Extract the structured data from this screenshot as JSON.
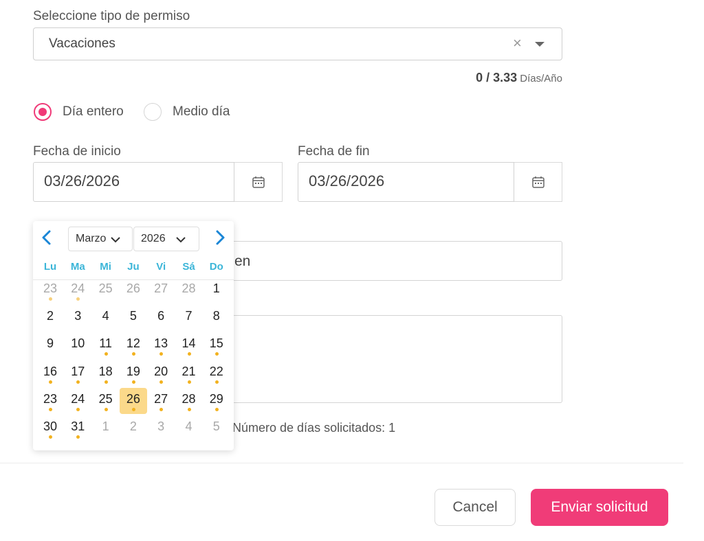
{
  "leave_type": {
    "label": "Seleccione tipo de permiso",
    "value": "Vacaciones",
    "clear_glyph": "×"
  },
  "balance": {
    "used": "0 / 3.33",
    "unit": "Días/Año"
  },
  "duration": {
    "options": [
      {
        "label": "Día entero",
        "checked": true
      },
      {
        "label": "Medio día",
        "checked": false
      }
    ]
  },
  "start_date": {
    "label": "Fecha de inicio",
    "value": "03/26/2026"
  },
  "end_date": {
    "label": "Fecha de fin",
    "value": "03/26/2026"
  },
  "partial_field_text": "en",
  "days_requested": "Número de días solicitados: 1",
  "calendar": {
    "month": "Marzo",
    "year": "2026",
    "weekdays": [
      "Lu",
      "Ma",
      "Mi",
      "Ju",
      "Vi",
      "Sá",
      "Do"
    ],
    "weeks": [
      [
        {
          "d": "23",
          "m": true,
          "dot": "light"
        },
        {
          "d": "24",
          "m": true,
          "dot": "light"
        },
        {
          "d": "25",
          "m": true
        },
        {
          "d": "26",
          "m": true
        },
        {
          "d": "27",
          "m": true
        },
        {
          "d": "28",
          "m": true
        },
        {
          "d": "1"
        }
      ],
      [
        {
          "d": "2"
        },
        {
          "d": "3"
        },
        {
          "d": "4"
        },
        {
          "d": "5"
        },
        {
          "d": "6"
        },
        {
          "d": "7"
        },
        {
          "d": "8"
        }
      ],
      [
        {
          "d": "9"
        },
        {
          "d": "10"
        },
        {
          "d": "11",
          "dot": "on"
        },
        {
          "d": "12",
          "dot": "on"
        },
        {
          "d": "13",
          "dot": "on"
        },
        {
          "d": "14",
          "dot": "on"
        },
        {
          "d": "15",
          "dot": "on"
        }
      ],
      [
        {
          "d": "16",
          "dot": "on"
        },
        {
          "d": "17",
          "dot": "on"
        },
        {
          "d": "18",
          "dot": "on"
        },
        {
          "d": "19",
          "dot": "on"
        },
        {
          "d": "20",
          "dot": "on"
        },
        {
          "d": "21",
          "dot": "on"
        },
        {
          "d": "22",
          "dot": "on"
        }
      ],
      [
        {
          "d": "23",
          "dot": "on"
        },
        {
          "d": "24",
          "dot": "on"
        },
        {
          "d": "25",
          "dot": "on"
        },
        {
          "d": "26",
          "dot": "on",
          "sel": true
        },
        {
          "d": "27",
          "dot": "on"
        },
        {
          "d": "28",
          "dot": "on"
        },
        {
          "d": "29",
          "dot": "on"
        }
      ],
      [
        {
          "d": "30",
          "dot": "on"
        },
        {
          "d": "31",
          "dot": "on"
        },
        {
          "d": "1",
          "m": true
        },
        {
          "d": "2",
          "m": true
        },
        {
          "d": "3",
          "m": true
        },
        {
          "d": "4",
          "m": true
        },
        {
          "d": "5",
          "m": true
        }
      ]
    ]
  },
  "buttons": {
    "cancel": "Cancel",
    "submit": "Enviar solicitud"
  },
  "colors": {
    "accent": "#f03c78",
    "weekday": "#3bb5d8",
    "nav_arrow": "#1a86d6",
    "selected_day": "#fbd98a",
    "dot": "#f2b21f"
  },
  "icons": {
    "calendar": "calendar-icon",
    "caret": "caret-down-icon",
    "prev": "chevron-left-icon",
    "next": "chevron-right-icon"
  }
}
